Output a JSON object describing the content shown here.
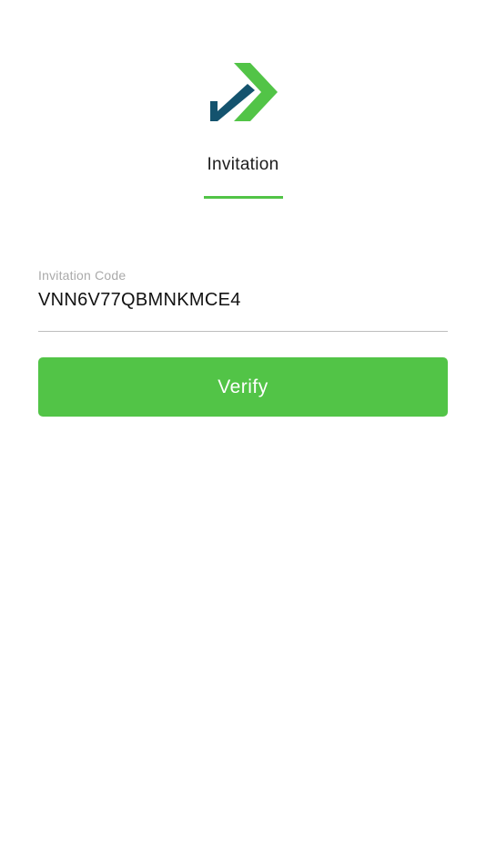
{
  "logo": {
    "icon": "checkmark-chevron-logo",
    "colors": {
      "dark": "#14536e",
      "accent": "#52c447"
    }
  },
  "header": {
    "title": "Invitation"
  },
  "invitation_field": {
    "label": "Invitation Code",
    "value": "VNN6V77QBMNKMCE4"
  },
  "actions": {
    "verify_label": "Verify"
  },
  "theme": {
    "accent": "#52c447",
    "background": "#ffffff"
  }
}
